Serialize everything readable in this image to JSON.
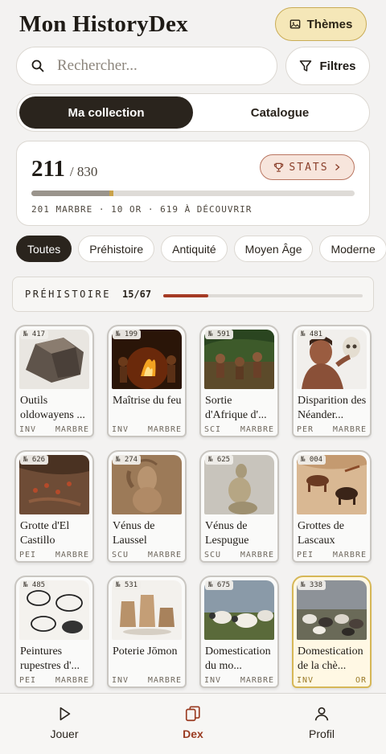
{
  "header": {
    "title": "Mon HistoryDex",
    "themes_label": "Thèmes"
  },
  "search": {
    "placeholder": "Rechercher...",
    "value": ""
  },
  "filters_label": "Filtres",
  "tabs": [
    {
      "label": "Ma collection",
      "active": true
    },
    {
      "label": "Catalogue",
      "active": false
    }
  ],
  "stats": {
    "collected": "211",
    "total": "/ 830",
    "button_label": "STATS",
    "breakdown": "201 MARBRE · 10 OR · 619 À DÉCOUVRIR",
    "marble_fraction": 0.242,
    "gold_fraction": 0.012
  },
  "chips": [
    {
      "label": "Toutes",
      "active": true
    },
    {
      "label": "Préhistoire",
      "active": false
    },
    {
      "label": "Antiquité",
      "active": false
    },
    {
      "label": "Moyen Âge",
      "active": false
    },
    {
      "label": "Moderne",
      "active": false
    }
  ],
  "section": {
    "name": "PRÉHISTOIRE",
    "progress": "15/67",
    "fraction": 0.224
  },
  "cards": [
    {
      "num": "№ 417",
      "title": "Outils oldowayens ...",
      "type": "INV",
      "tier": "MARBRE",
      "gold": false,
      "icon": "stone-tool"
    },
    {
      "num": "№ 199",
      "title": "Maîtrise du feu",
      "type": "INV",
      "tier": "MARBRE",
      "gold": false,
      "icon": "campfire"
    },
    {
      "num": "№ 591",
      "title": "Sortie d'Afrique d'...",
      "type": "SCI",
      "tier": "MARBRE",
      "gold": false,
      "icon": "early-humans"
    },
    {
      "num": "№ 481",
      "title": "Disparition des Néander...",
      "type": "PER",
      "tier": "MARBRE",
      "gold": false,
      "icon": "neanderthal"
    },
    {
      "num": "№ 626",
      "title": "Grotte d'El Castillo",
      "type": "PEI",
      "tier": "MARBRE",
      "gold": false,
      "icon": "cave-painting"
    },
    {
      "num": "№ 274",
      "title": "Vénus de Laussel",
      "type": "SCU",
      "tier": "MARBRE",
      "gold": false,
      "icon": "relief"
    },
    {
      "num": "№ 625",
      "title": "Vénus de Lespugue",
      "type": "SCU",
      "tier": "MARBRE",
      "gold": false,
      "icon": "figurine"
    },
    {
      "num": "№ 004",
      "title": "Grottes de Lascaux",
      "type": "PEI",
      "tier": "MARBRE",
      "gold": false,
      "icon": "cave-animals"
    },
    {
      "num": "№ 485",
      "title": "Peintures rupestres d'...",
      "type": "PEI",
      "tier": "MARBRE",
      "gold": false,
      "icon": "sketch"
    },
    {
      "num": "№ 531",
      "title": "Poterie Jōmon",
      "type": "INV",
      "tier": "MARBRE",
      "gold": false,
      "icon": "pottery"
    },
    {
      "num": "№ 675",
      "title": "Domestication du mo...",
      "type": "INV",
      "tier": "MARBRE",
      "gold": false,
      "icon": "sheep"
    },
    {
      "num": "№ 338",
      "title": "Domestication de la chè...",
      "type": "INV",
      "tier": "OR",
      "gold": true,
      "icon": "goats"
    }
  ],
  "nav": [
    {
      "label": "Jouer",
      "active": false,
      "icon": "play-icon"
    },
    {
      "label": "Dex",
      "active": true,
      "icon": "cards-icon"
    },
    {
      "label": "Profil",
      "active": false,
      "icon": "person-icon"
    }
  ],
  "colors": {
    "accent": "#9a3b21",
    "gold": "#c9a24a",
    "dark": "#2a241d"
  }
}
